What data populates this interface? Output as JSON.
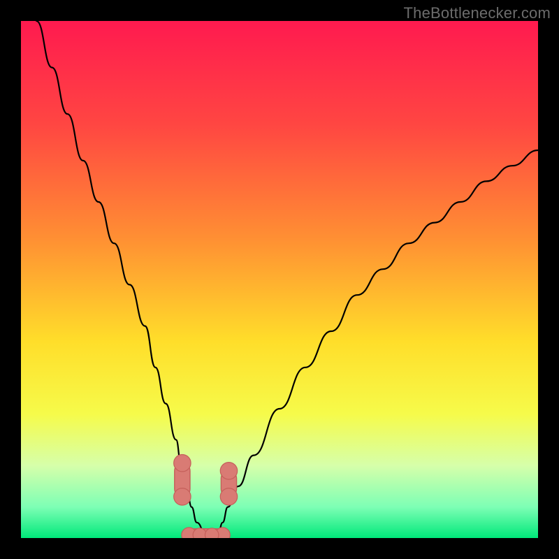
{
  "watermark": "TheBottlenecker.com",
  "chart_data": {
    "type": "line",
    "title": "",
    "xlabel": "",
    "ylabel": "",
    "xlim": [
      0,
      100
    ],
    "ylim": [
      0,
      100
    ],
    "grid": false,
    "legend": false,
    "background_gradient": {
      "stops": [
        {
          "offset": 0,
          "color": "#ff1a4f"
        },
        {
          "offset": 0.2,
          "color": "#ff4642"
        },
        {
          "offset": 0.42,
          "color": "#ff8f33"
        },
        {
          "offset": 0.62,
          "color": "#ffde2a"
        },
        {
          "offset": 0.76,
          "color": "#f6fb4a"
        },
        {
          "offset": 0.86,
          "color": "#d6ffaa"
        },
        {
          "offset": 0.94,
          "color": "#7dffb5"
        },
        {
          "offset": 1.0,
          "color": "#00e87a"
        }
      ]
    },
    "series": [
      {
        "name": "bottleneck-curve",
        "stroke": "#000000",
        "stroke_width": 2.2,
        "x": [
          3,
          6,
          9,
          12,
          15,
          18,
          21,
          24,
          26,
          28,
          30,
          31,
          32,
          33,
          34,
          36,
          38,
          39,
          40,
          42,
          45,
          50,
          55,
          60,
          65,
          70,
          75,
          80,
          85,
          90,
          95,
          100
        ],
        "y": [
          100,
          91,
          82,
          73,
          65,
          57,
          49,
          41,
          33,
          26,
          19,
          14,
          10,
          6,
          3,
          0,
          0,
          3,
          6,
          10,
          16,
          25,
          33,
          40,
          47,
          52,
          57,
          61,
          65,
          69,
          72,
          75
        ]
      }
    ],
    "marker_bars": [
      {
        "name": "left-load-bar",
        "x": 31.2,
        "y0": 14.5,
        "y1": 8.0,
        "width": 3.0,
        "color": "#d97b74",
        "outline": "#c55f5a"
      },
      {
        "name": "right-load-bar",
        "x": 40.2,
        "y0": 8.0,
        "y1": 13.0,
        "width": 3.0,
        "color": "#d97b74",
        "outline": "#c55f5a"
      }
    ],
    "flat_segment": {
      "name": "flat-bottom",
      "x0": 32.5,
      "x1": 39.0,
      "y": 0.6,
      "height": 2.4,
      "color": "#d97b74",
      "outline": "#c55f5a"
    }
  }
}
